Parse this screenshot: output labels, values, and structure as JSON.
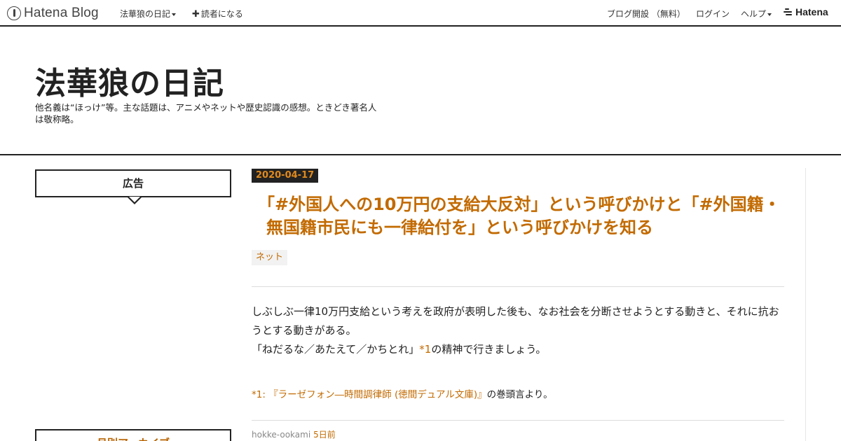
{
  "topbar": {
    "logo_text": "Hatena Blog",
    "blog_menu": "法華狼の日記",
    "subscribe": "読者になる",
    "open_blog": "ブログ開設 （無料）",
    "login": "ログイン",
    "help": "ヘルプ",
    "hatena": "Hatena"
  },
  "blog": {
    "title": "法華狼の日記",
    "description": "他名義は“ほっけ”等。主な話題は、アニメやネットや歴史認識の感想。ときどき著名人は敬称略。"
  },
  "sidebar": {
    "ad_label": "広告",
    "archive_label": "月別アーカイブ"
  },
  "entry": {
    "date": "2020-04-17",
    "title": "「#外国人への10万円の支給大反対」という呼びかけと「#外国籍・無国籍市民にも一律給付を」という呼びかけを知る",
    "category": "ネット",
    "para1": "しぶしぶ一律10万円支給という考えを政府が表明した後も、なお社会を分断させようとする動きと、それに抗おうとする動きがある。",
    "para2_pre": "「ねだるな／あたえて／かちとれ」",
    "para2_ref": "*1",
    "para2_post": "の精神で行きましょう。",
    "footnote_mark": "*1:",
    "footnote_link": "『ラーゼフォン―時間調律師 (徳間デュアル文庫)』",
    "footnote_post": "の巻頭言より。",
    "author": "hokke-ookami",
    "time_ago": "5日前"
  }
}
